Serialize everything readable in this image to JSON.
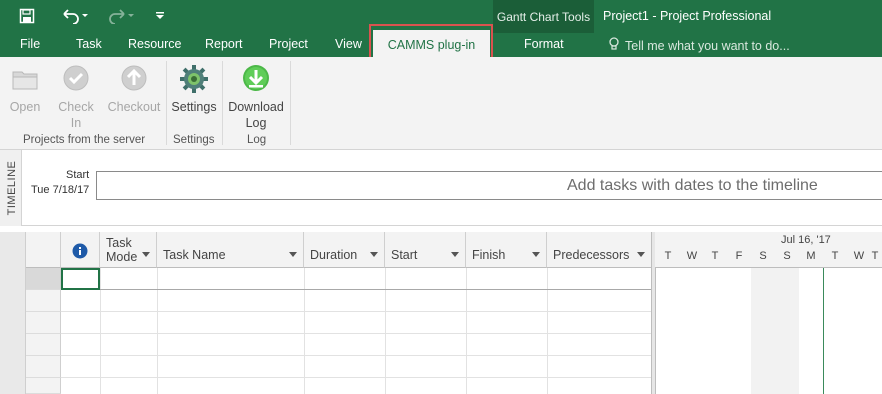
{
  "quick_access": {
    "save_icon": "save-icon",
    "undo_icon": "undo-icon",
    "redo_icon": "redo-icon",
    "customize_icon": "customize-qat-icon"
  },
  "context_tab_group": "Gantt Chart Tools",
  "app_title": "Project1  -  Project Professional",
  "tabs": [
    "File",
    "Task",
    "Resource",
    "Report",
    "Project",
    "View"
  ],
  "active_tab": "CAMMS plug-in",
  "context_tab": "Format",
  "tell_me": "Tell me what you want to do...",
  "ribbon": {
    "buttons": [
      {
        "label": "Open",
        "label2": "",
        "enabled": false,
        "icon": "folder-icon"
      },
      {
        "label": "Check",
        "label2": "In",
        "enabled": false,
        "icon": "check-in-icon"
      },
      {
        "label": "Checkout",
        "label2": "",
        "enabled": false,
        "icon": "checkout-icon"
      },
      {
        "label": "Settings",
        "label2": "",
        "enabled": true,
        "icon": "gear-icon"
      },
      {
        "label": "Download",
        "label2": "Log",
        "enabled": true,
        "icon": "download-icon"
      }
    ],
    "groups": [
      "Projects from the server",
      "Settings",
      "Log"
    ]
  },
  "timeline": {
    "side_label": "TIMELINE",
    "start_label": "Start",
    "start_date": "Tue 7/18/17",
    "hint": "Add tasks with dates to the timeline"
  },
  "grid": {
    "columns": [
      {
        "key": "info",
        "label": "",
        "icon": "info-icon"
      },
      {
        "key": "mode",
        "label": "Task",
        "label2": "Mode"
      },
      {
        "key": "name",
        "label": "Task Name"
      },
      {
        "key": "duration",
        "label": "Duration"
      },
      {
        "key": "start",
        "label": "Start"
      },
      {
        "key": "finish",
        "label": "Finish"
      },
      {
        "key": "pred",
        "label": "Predecessors"
      }
    ]
  },
  "gantt": {
    "week_label": "Jul 16, '17",
    "days": [
      "T",
      "W",
      "T",
      "F",
      "S",
      "S",
      "M",
      "T",
      "W",
      "T"
    ]
  },
  "colors": {
    "brand": "#217346",
    "highlight": "#d9534f"
  }
}
